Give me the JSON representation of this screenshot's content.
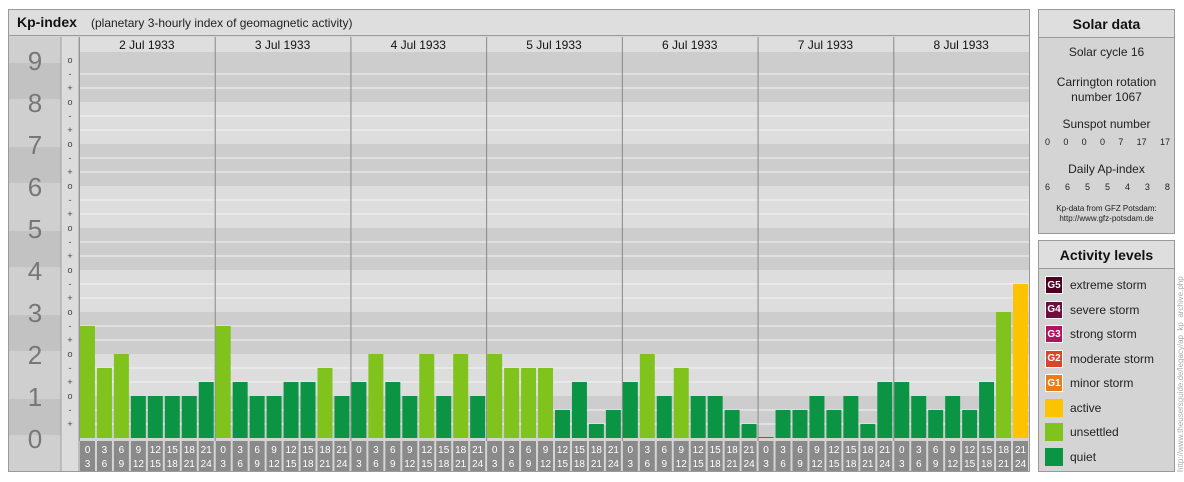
{
  "header": {
    "title": "Kp-index",
    "subtitle": "(planetary 3-hourly index of geomagnetic activity)"
  },
  "chart_data": {
    "type": "bar",
    "title": "Kp-index",
    "subtitle": "(planetary 3-hourly index of geomagnetic activity)",
    "ylim": [
      0,
      9
    ],
    "y_major_ticks": [
      "0",
      "1",
      "2",
      "3",
      "4",
      "5",
      "6",
      "7",
      "8",
      "9"
    ],
    "y_minor_ticks": [
      "o",
      "+",
      "-"
    ],
    "days": [
      "2 Jul 1933",
      "3 Jul 1933",
      "4 Jul 1933",
      "5 Jul 1933",
      "6 Jul 1933",
      "7 Jul 1933",
      "8 Jul 1933"
    ],
    "hour_starts": [
      "0",
      "3",
      "6",
      "9",
      "12",
      "15",
      "18",
      "21"
    ],
    "hour_ends": [
      "3",
      "6",
      "9",
      "12",
      "15",
      "18",
      "21",
      "24"
    ],
    "values": [
      2.667,
      1.667,
      2.0,
      1.0,
      1.0,
      1.0,
      1.0,
      1.333,
      2.667,
      1.333,
      1.0,
      1.0,
      1.333,
      1.333,
      1.667,
      1.0,
      1.333,
      2.0,
      1.333,
      1.0,
      2.0,
      1.0,
      2.0,
      1.0,
      2.0,
      1.667,
      1.667,
      1.667,
      0.667,
      1.333,
      0.333,
      0.667,
      1.333,
      2.0,
      1.0,
      1.667,
      1.0,
      1.0,
      0.667,
      0.333,
      0.0,
      0.667,
      0.667,
      1.0,
      0.667,
      1.0,
      0.333,
      1.333,
      1.333,
      1.0,
      0.667,
      1.0,
      0.667,
      1.333,
      3.0,
      3.667
    ],
    "colors": {
      "quiet": "#0a9444",
      "unsettled": "#7fc31c",
      "active": "#fdc300"
    },
    "grid": true
  },
  "solar": {
    "title": "Solar data",
    "cycle": "Solar cycle 16",
    "carrington_l1": "Carrington rotation",
    "carrington_l2": "number 1067",
    "sunspot_label": "Sunspot number",
    "sunspot_values": [
      "0",
      "0",
      "0",
      "0",
      "7",
      "17",
      "17"
    ],
    "ap_label": "Daily Ap-index",
    "ap_values": [
      "6",
      "6",
      "5",
      "5",
      "4",
      "3",
      "8"
    ],
    "source_l1": "Kp-data from GFZ Potsdam:",
    "source_l2": "http://www.gfz-potsdam.de"
  },
  "activity": {
    "title": "Activity levels",
    "items": [
      {
        "code": "G5",
        "label": "extreme storm",
        "color": "#4d0020"
      },
      {
        "code": "G4",
        "label": "severe storm",
        "color": "#6d1040"
      },
      {
        "code": "G3",
        "label": "strong storm",
        "color": "#b0145c"
      },
      {
        "code": "G2",
        "label": "moderate storm",
        "color": "#d9452b"
      },
      {
        "code": "G1",
        "label": "minor storm",
        "color": "#e77d1b"
      },
      {
        "code": "",
        "label": "active",
        "color": "#fdc300"
      },
      {
        "code": "",
        "label": "unsettled",
        "color": "#7fc31c"
      },
      {
        "code": "",
        "label": "quiet",
        "color": "#0a9444"
      }
    ]
  },
  "credit": "http://www.theusersguide.de/legacy/ap_kp_archive.php"
}
